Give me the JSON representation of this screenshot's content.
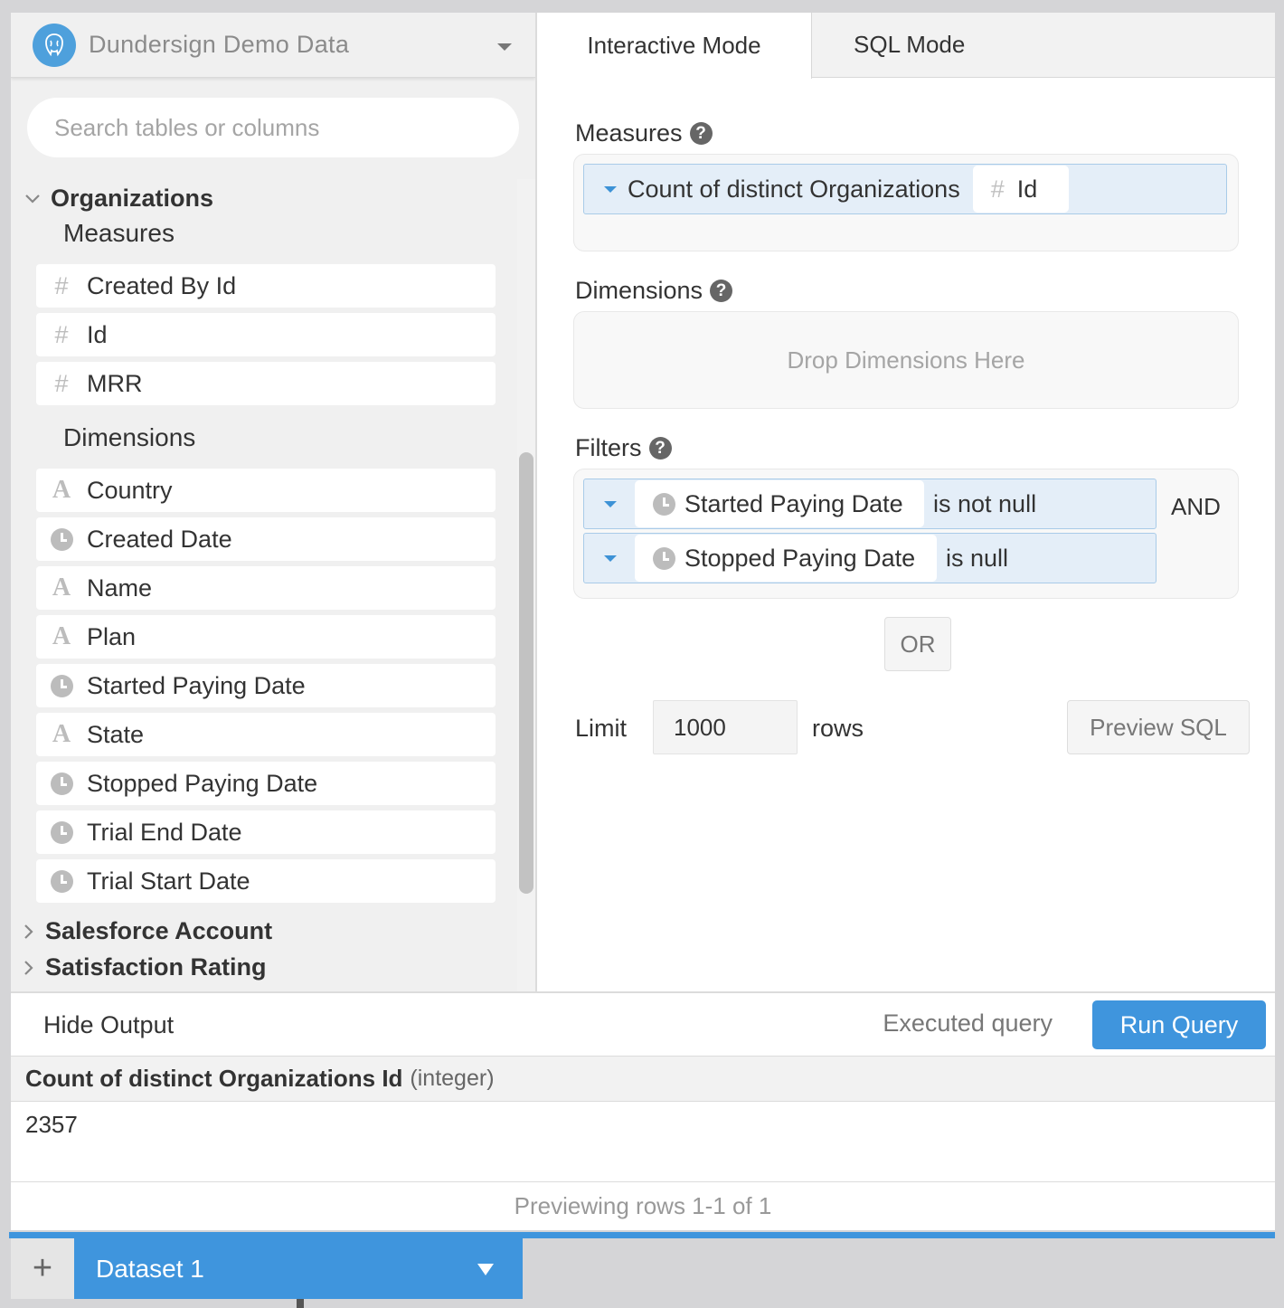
{
  "datasource": {
    "name": "Dundersign Demo Data",
    "icon": "postgres-elephant-icon",
    "accent": "#4ea0dc"
  },
  "search": {
    "placeholder": "Search tables or columns"
  },
  "tree": {
    "table": "Organizations",
    "measures_label": "Measures",
    "measures": [
      {
        "icon": "hash",
        "label": "Created By Id"
      },
      {
        "icon": "hash",
        "label": "Id"
      },
      {
        "icon": "hash",
        "label": "MRR"
      }
    ],
    "dimensions_label": "Dimensions",
    "dimensions": [
      {
        "icon": "text",
        "label": "Country"
      },
      {
        "icon": "clock",
        "label": "Created Date"
      },
      {
        "icon": "text",
        "label": "Name"
      },
      {
        "icon": "text",
        "label": "Plan"
      },
      {
        "icon": "clock",
        "label": "Started Paying Date"
      },
      {
        "icon": "text",
        "label": "State"
      },
      {
        "icon": "clock",
        "label": "Stopped Paying Date"
      },
      {
        "icon": "clock",
        "label": "Trial End Date"
      },
      {
        "icon": "clock",
        "label": "Trial Start Date"
      }
    ],
    "collapsed_tables": [
      "Salesforce Account",
      "Satisfaction Rating"
    ]
  },
  "tabs": {
    "interactive": "Interactive Mode",
    "sql": "SQL Mode"
  },
  "builder": {
    "measures_label": "Measures",
    "measure_pill": {
      "aggregation": "Count of distinct Organizations",
      "field": "Id"
    },
    "dimensions_label": "Dimensions",
    "dimensions_placeholder": "Drop Dimensions Here",
    "filters_label": "Filters",
    "filters": [
      {
        "field": "Started Paying Date",
        "condition": "is not null"
      },
      {
        "field": "Stopped Paying Date",
        "condition": "is null"
      }
    ],
    "and_label": "AND",
    "or_label": "OR",
    "limit_label": "Limit",
    "limit_value": "1000",
    "rows_label": "rows",
    "preview_sql": "Preview SQL",
    "help_glyph": "?"
  },
  "output": {
    "hide_label": "Hide Output",
    "status": "Executed query",
    "run_label": "Run Query",
    "column_name": "Count of distinct Organizations Id",
    "column_type": "(integer)",
    "value": "2357",
    "footer": "Previewing rows 1-1 of 1"
  },
  "datasets": {
    "add_glyph": "+",
    "active": "Dataset 1"
  },
  "colors": {
    "accent_blue": "#3f95dd",
    "pill_bg": "#e4eef8",
    "pill_border": "#a9cbe8"
  }
}
